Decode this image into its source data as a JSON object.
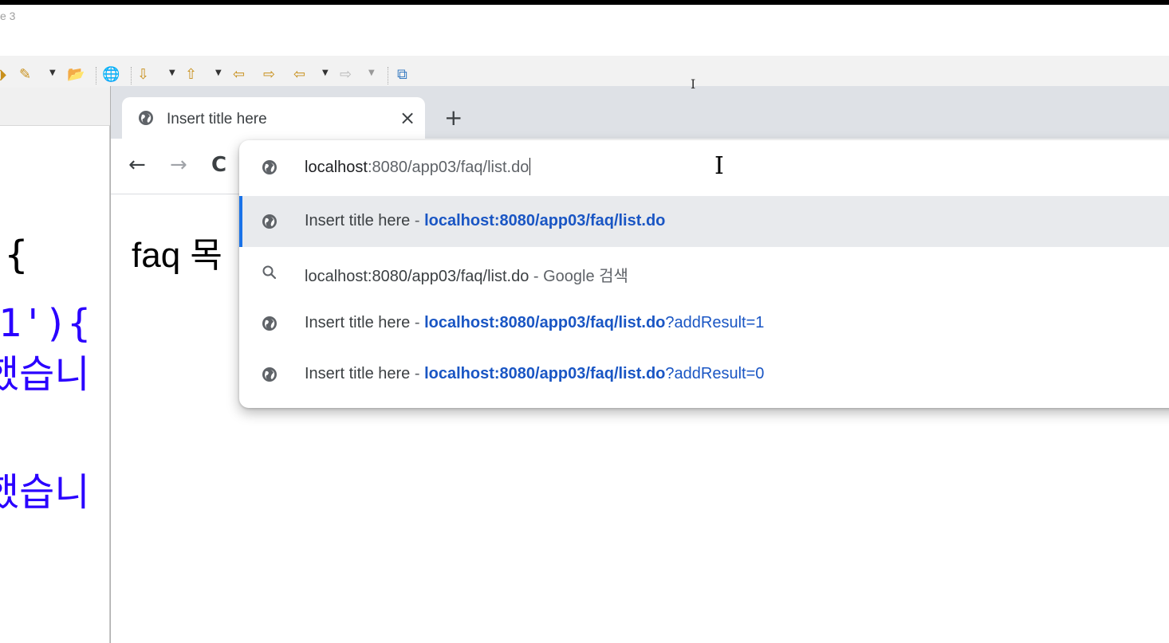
{
  "eclipse": {
    "title_fragment": "e 3",
    "code_lines": [
      {
        "text": "{",
        "color": "black"
      },
      {
        "text": "1'){",
        "color": "blue"
      },
      {
        "text": "했습니",
        "color": "blue"
      },
      {
        "text": "했습니",
        "color": "blue"
      }
    ]
  },
  "chrome": {
    "tab": {
      "title": "Insert title here",
      "close_label": "×"
    },
    "new_tab_label": "+",
    "nav": {
      "back": "←",
      "forward": "→",
      "reload": "C"
    },
    "page_heading": "faq 목",
    "omnibox": {
      "input_host": "localhost",
      "input_path": ":8080/app03/faq/list.do",
      "suggestions": [
        {
          "title": "Insert title here",
          "sep": " - ",
          "url": "localhost:8080/app03/faq/list.do",
          "rest": "",
          "icon": "globe-icon",
          "selected": true
        },
        {
          "title": "localhost:8080/app03/faq/list.do",
          "sep": " - ",
          "url": "",
          "rest": "Google 검색",
          "icon": "search-icon",
          "selected": false
        },
        {
          "title": "Insert title here",
          "sep": " - ",
          "url": "localhost:8080/app03/faq/list.do",
          "rest": "?addResult=1",
          "icon": "globe-icon",
          "selected": false
        },
        {
          "title": "Insert title here",
          "sep": " - ",
          "url": "localhost:8080/app03/faq/list.do",
          "rest": "?addResult=0",
          "icon": "globe-icon",
          "selected": false
        }
      ]
    }
  },
  "colors": {
    "accent": "#1a73e8",
    "link": "#1a56c4",
    "code_blue": "#2a00ff",
    "tabstrip": "#dee1e6"
  }
}
